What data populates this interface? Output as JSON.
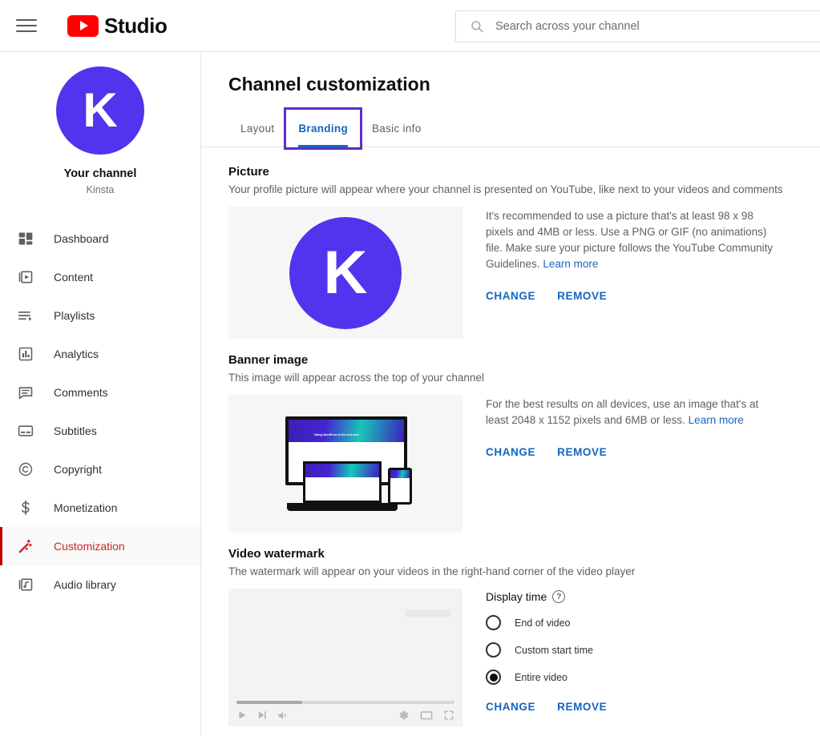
{
  "topbar": {
    "menu_icon": "hamburger-icon",
    "logo_icon": "youtube-play-icon",
    "brand": "Studio",
    "search": {
      "icon": "search-icon",
      "placeholder": "Search across your channel",
      "value": ""
    }
  },
  "sidebar": {
    "avatar_letter": "K",
    "avatar_color": "#5333ed",
    "channel_title": "Your channel",
    "channel_name": "Kinsta",
    "active_color": "#c62828",
    "items": [
      {
        "label": "Dashboard",
        "icon": "dashboard-icon",
        "active": false
      },
      {
        "label": "Content",
        "icon": "content-icon",
        "active": false
      },
      {
        "label": "Playlists",
        "icon": "playlists-icon",
        "active": false
      },
      {
        "label": "Analytics",
        "icon": "analytics-icon",
        "active": false
      },
      {
        "label": "Comments",
        "icon": "comments-icon",
        "active": false
      },
      {
        "label": "Subtitles",
        "icon": "subtitles-icon",
        "active": false
      },
      {
        "label": "Copyright",
        "icon": "copyright-icon",
        "active": false
      },
      {
        "label": "Monetization",
        "icon": "dollar-icon",
        "active": false
      },
      {
        "label": "Customization",
        "icon": "magic-wand-icon",
        "active": true
      },
      {
        "label": "Audio library",
        "icon": "audio-library-icon",
        "active": false
      }
    ]
  },
  "main": {
    "page_title": "Channel customization",
    "tabs": [
      {
        "label": "Layout",
        "selected": false,
        "focused": false
      },
      {
        "label": "Branding",
        "selected": true,
        "focused": true
      },
      {
        "label": "Basic info",
        "selected": false,
        "focused": false
      }
    ],
    "focus_ring_color": "#5b2ec9",
    "accent_color": "#1565c0",
    "sections": [
      {
        "id": "picture",
        "title": "Picture",
        "description": "Your profile picture will appear where your channel is presented on YouTube, like next to your videos and comments",
        "help_text": "It's recommended to use a picture that's at least 98 x 98 pixels and 4MB or less. Use a PNG or GIF (no animations) file. Make sure your picture follows the YouTube Community Guidelines.",
        "help_link": "Learn more",
        "change_label": "CHANGE",
        "remove_label": "REMOVE"
      },
      {
        "id": "banner",
        "title": "Banner image",
        "description": "This image will appear across the top of your channel",
        "help_text": "For the best results on all devices, use an image that's at least 2048 x 1152 pixels and 6MB or less.",
        "help_link": "Learn more",
        "change_label": "CHANGE",
        "remove_label": "REMOVE",
        "banner_headline": "Taking WordPress to the next level"
      },
      {
        "id": "watermark",
        "title": "Video watermark",
        "description": "The watermark will appear on your videos in the right-hand corner of the video player",
        "display_time_label": "Display time",
        "help_icon": "question-mark-icon",
        "options": [
          {
            "label": "End of video",
            "checked": false
          },
          {
            "label": "Custom start time",
            "checked": false
          },
          {
            "label": "Entire video",
            "checked": true
          }
        ],
        "change_label": "CHANGE",
        "remove_label": "REMOVE",
        "player_icons": [
          "play-icon",
          "next-icon",
          "volume-icon",
          "settings-gear-icon",
          "theater-mode-icon",
          "fullscreen-icon"
        ]
      }
    ]
  }
}
